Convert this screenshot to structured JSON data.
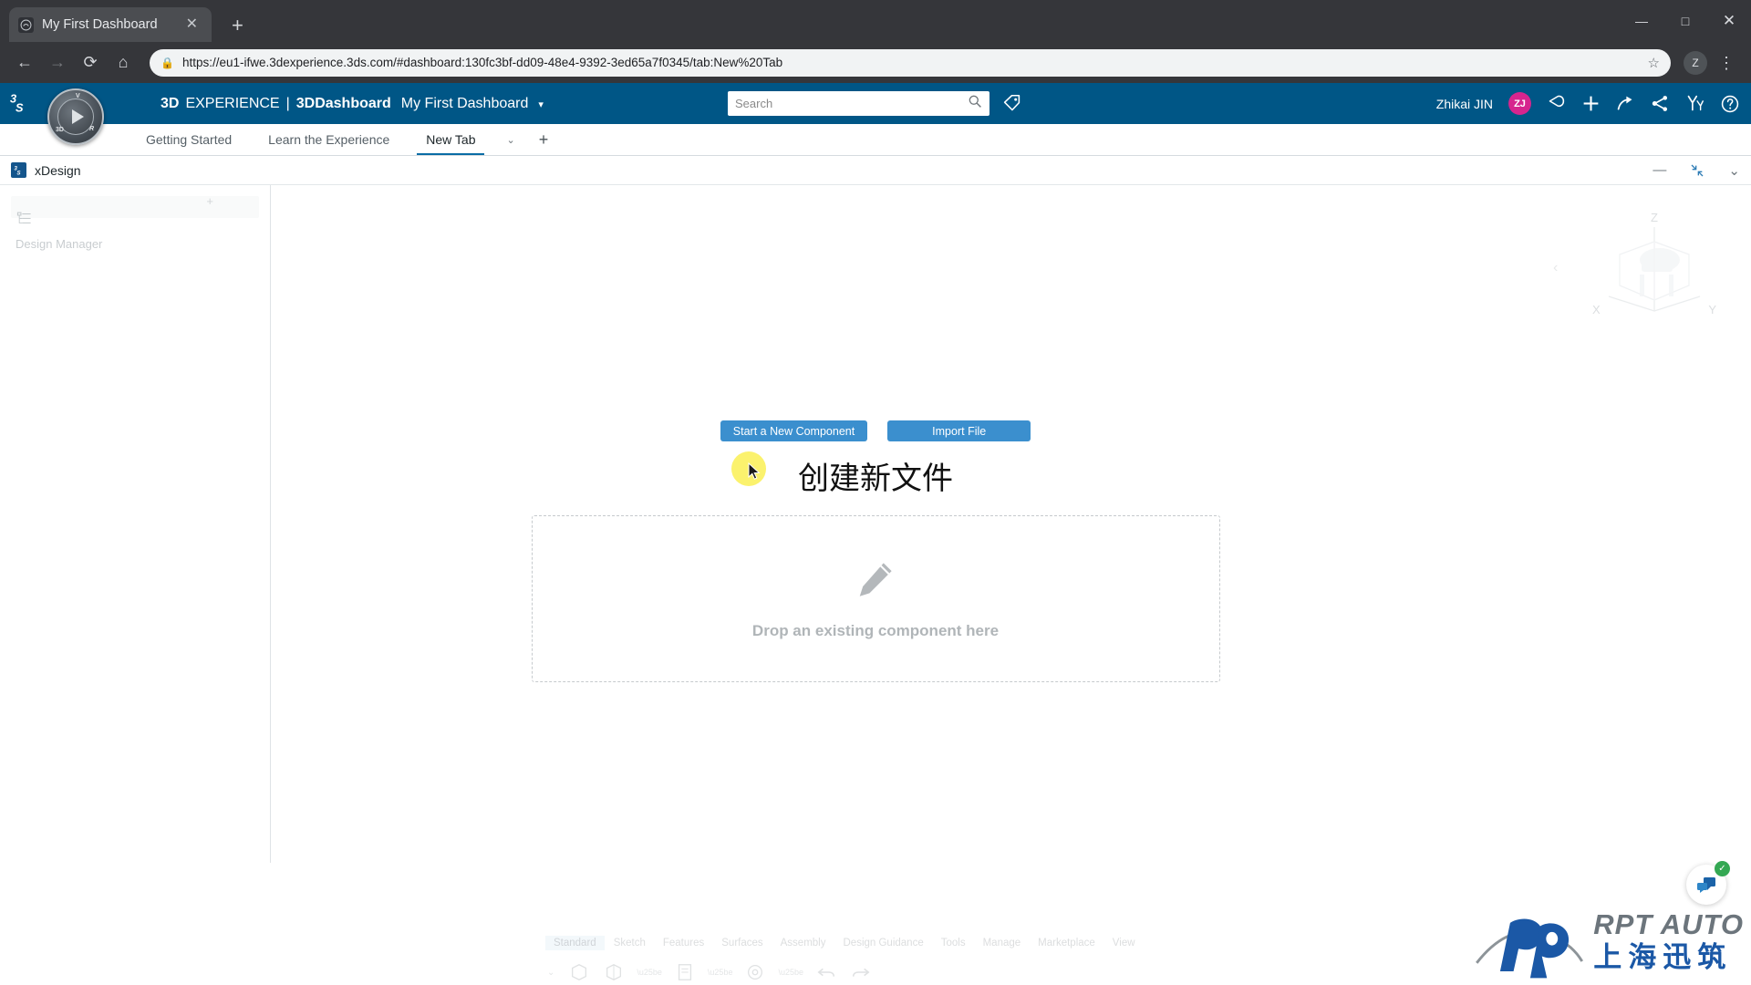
{
  "browser": {
    "tab": {
      "title": "My First Dashboard",
      "favicon": "3ds-favicon",
      "close_label": "✕"
    },
    "new_tab_label": "+",
    "window_controls": {
      "minimize": "—",
      "maximize": "□",
      "close": "✕"
    },
    "nav": {
      "back": "←",
      "forward": "→",
      "reload": "⟳",
      "home": "⌂"
    },
    "omnibox": {
      "url": "https://eu1-ifwe.3dexperience.3ds.com/#dashboard:130fc3bf-dd09-48e4-9392-3ed65a7f0345/tab:New%20Tab",
      "lock": "🔒",
      "star": "☆"
    },
    "profile_initial": "Z",
    "menu": "⋮"
  },
  "dx_header": {
    "brand_bold": "3D",
    "brand_rest": "EXPERIENCE",
    "separator": "|",
    "product": "3DDashboard",
    "dashboard_name": "My First Dashboard",
    "caret": "▾",
    "compass": {
      "label_3d": "3D",
      "label_v": "V",
      "label_r": "R"
    },
    "search": {
      "placeholder": "Search",
      "value": "",
      "icon": "search-icon"
    },
    "tag_icon": "tag-icon",
    "user_name": "Zhikai JIN",
    "avatar_initials": "ZJ",
    "avatar_color": "#d6258e",
    "icons": [
      "notification-icon",
      "add-icon",
      "share-arrow-icon",
      "share-network-icon",
      "collaborate-icon",
      "help-icon"
    ]
  },
  "dashboard_tabs": {
    "items": [
      {
        "label": "Getting Started",
        "active": false
      },
      {
        "label": "Learn the Experience",
        "active": false
      },
      {
        "label": "New Tab",
        "active": true
      }
    ],
    "caret": "⌄",
    "add": "+"
  },
  "widget": {
    "app_icon_text": "xD",
    "title": "xDesign",
    "actions": {
      "minimize": "—",
      "collapse": "collapse-icon",
      "chevron": "⌄"
    }
  },
  "tree_panel": {
    "label": "Design Manager",
    "plus": "+",
    "tree_icon": "tree-icon"
  },
  "canvas": {
    "buttons": {
      "start_component": "Start a New Component",
      "import_file": "Import File"
    },
    "annotation": "创建新文件",
    "dropzone": {
      "text": "Drop an existing component here",
      "icon": "pencil-icon"
    },
    "viewcube": {
      "x": "X",
      "y": "Y",
      "z": "Z",
      "caret": "‹"
    }
  },
  "ribbon": {
    "tabs": [
      "Standard",
      "Sketch",
      "Features",
      "Surfaces",
      "Assembly",
      "Design Guidance",
      "Tools",
      "Manage",
      "Marketplace",
      "View"
    ],
    "active_tab": "Standard",
    "icons": [
      "new-part-icon",
      "new-component-icon",
      "new-drawing-icon",
      "settings-icon",
      "undo-icon",
      "redo-icon"
    ],
    "collapse": "⌄"
  },
  "watermark": {
    "english": "RPT AUTO",
    "chinese": "上海迅筑",
    "logo": "rp-logo"
  },
  "chat": {
    "icon": "chat-icon",
    "badge": "✓"
  },
  "colors": {
    "dx_blue": "#005686",
    "button_blue": "#3b8fce",
    "accent": "#0a6ca5",
    "avatar": "#d6258e",
    "highlight": "#fbf26d"
  }
}
